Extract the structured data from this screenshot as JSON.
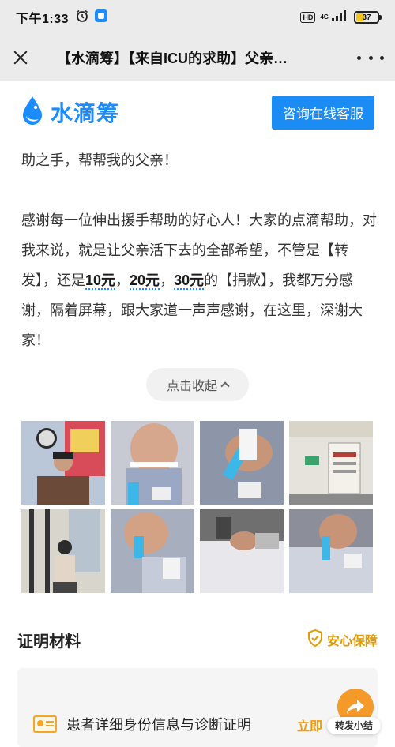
{
  "status_bar": {
    "time": "下午1:33",
    "network": "4G",
    "hd": "HD",
    "battery": "37",
    "battery_level": 0.37
  },
  "nav": {
    "title": "【水滴筹】【来自ICU的求助】父亲…"
  },
  "header": {
    "brand": "水滴筹",
    "consult_button": "咨询在线客服"
  },
  "content": {
    "para1": "助之手，帮帮我的父亲！",
    "para2_a": "感谢每一位伸出援手帮助的好心人！大家的点滴帮助，对我来说，就是让父亲活下去的全部希望，不管是【转发】，还是",
    "amount1": "10元",
    "sep1": "，",
    "amount2": "20元",
    "sep2": "，",
    "amount3": "30元",
    "para2_b": "的【捐款】，我都万分感谢，隔着屏幕，跟大家道一声声感谢，在这里，深谢大家！",
    "collapse": "点击收起"
  },
  "photos": [
    "photo-1",
    "photo-2",
    "photo-3",
    "photo-4",
    "photo-5",
    "photo-6",
    "photo-7",
    "photo-8"
  ],
  "proof": {
    "title": "证明材料",
    "safe_label": "安心保障",
    "item_label": "患者详细身份信息与诊断证明",
    "view_label": "立即"
  },
  "share": {
    "label": "转发小结"
  },
  "colors": {
    "brand_blue": "#1a8cff",
    "button_blue": "#1c8cf5",
    "accent_orange": "#f39a28"
  }
}
